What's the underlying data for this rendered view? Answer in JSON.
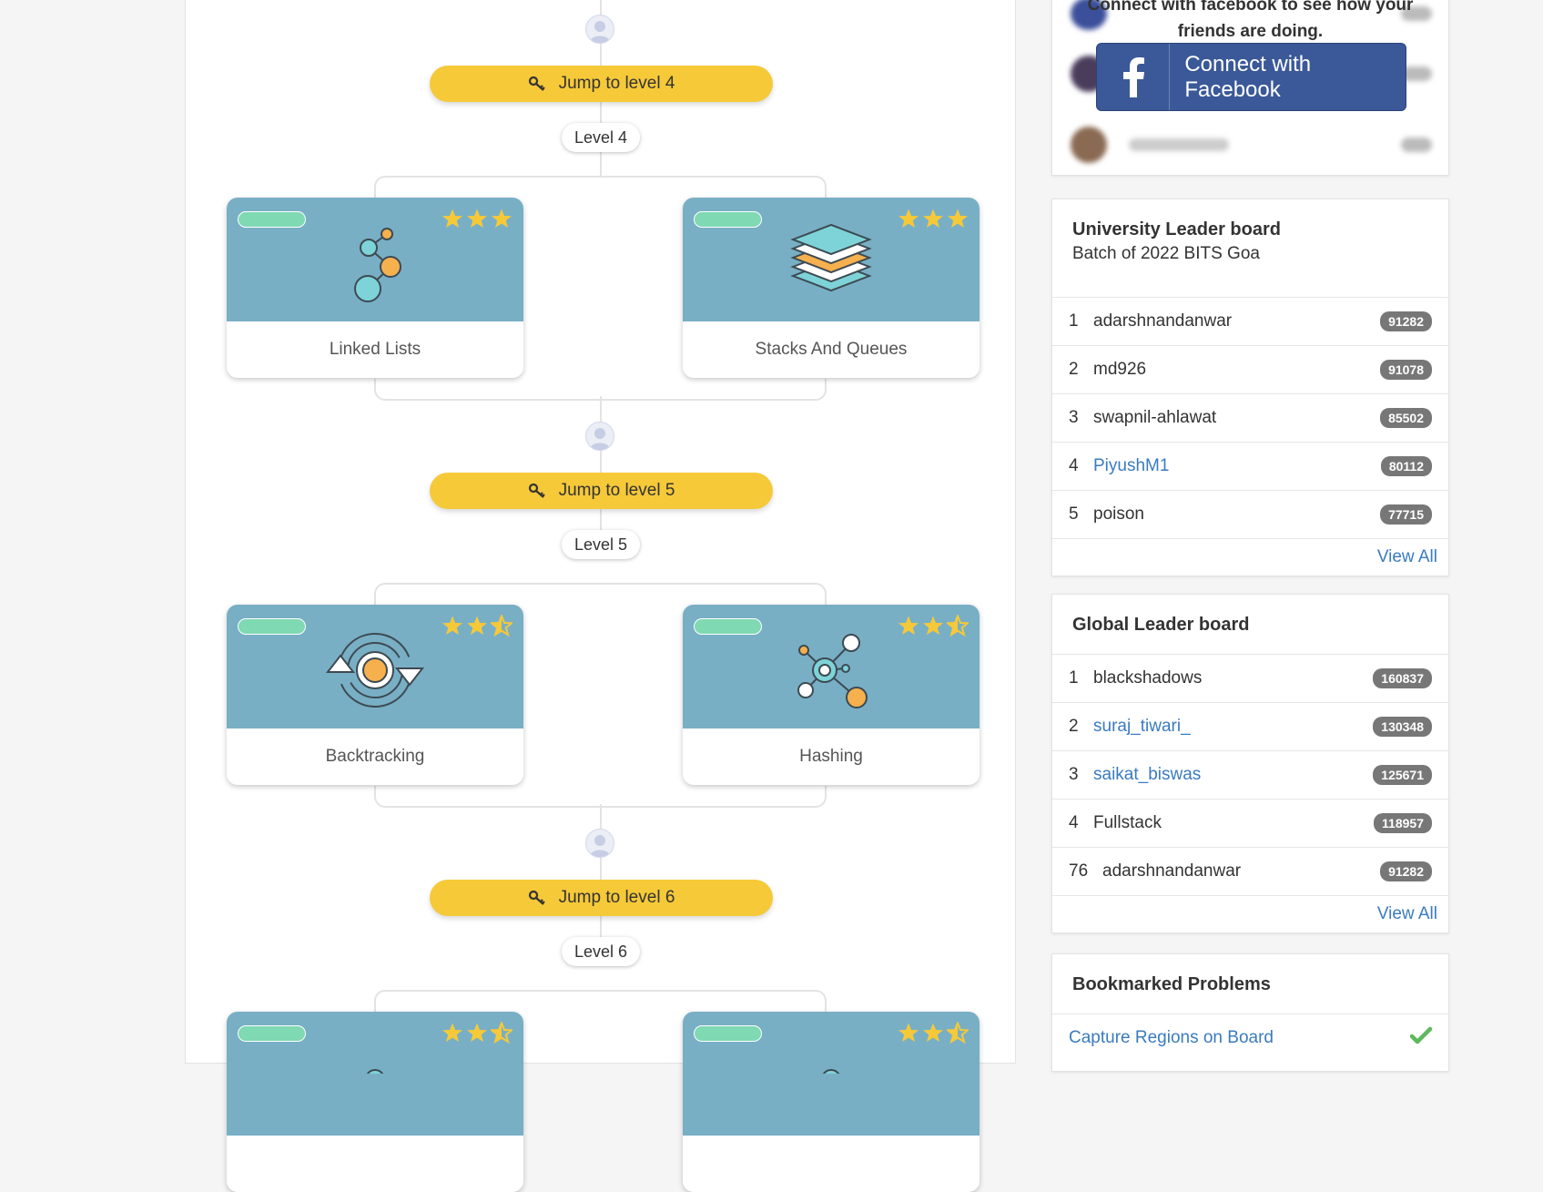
{
  "track": {
    "jump_buttons": [
      {
        "label": "Jump to level 4"
      },
      {
        "label": "Jump to level 5"
      },
      {
        "label": "Jump to level 6"
      }
    ],
    "levels": [
      {
        "label": "Level 4",
        "cards": [
          {
            "title": "Linked Lists",
            "stars": 3,
            "icon": "linked-list-icon"
          },
          {
            "title": "Stacks And Queues",
            "stars": 3,
            "icon": "stack-layers-icon"
          }
        ]
      },
      {
        "label": "Level 5",
        "cards": [
          {
            "title": "Backtracking",
            "stars": 2.5,
            "icon": "backtracking-icon"
          },
          {
            "title": "Hashing",
            "stars": 2.5,
            "icon": "hashing-icon"
          }
        ]
      },
      {
        "label": "Level 6",
        "cards": [
          {
            "title": "",
            "stars": 2.5
          },
          {
            "title": "",
            "stars": 2.5
          }
        ]
      }
    ]
  },
  "facebook": {
    "prompt": "Connect with facebook to see how your friends are doing.",
    "button_label": "Connect with Facebook"
  },
  "university_board": {
    "title": "University Leader board",
    "subtitle": "Batch of 2022 BITS Goa",
    "rows": [
      {
        "rank": "1",
        "name": "adarshnandanwar",
        "score": "91282",
        "link": false
      },
      {
        "rank": "2",
        "name": "md926",
        "score": "91078",
        "link": false
      },
      {
        "rank": "3",
        "name": "swapnil-ahlawat",
        "score": "85502",
        "link": false
      },
      {
        "rank": "4",
        "name": "PiyushM1",
        "score": "80112",
        "link": true
      },
      {
        "rank": "5",
        "name": "poison",
        "score": "77715",
        "link": false
      }
    ],
    "view_all": "View All"
  },
  "global_board": {
    "title": "Global Leader board",
    "rows": [
      {
        "rank": "1",
        "name": "blackshadows",
        "score": "160837",
        "link": false
      },
      {
        "rank": "2",
        "name": "suraj_tiwari_",
        "score": "130348",
        "link": true
      },
      {
        "rank": "3",
        "name": "saikat_biswas",
        "score": "125671",
        "link": true
      },
      {
        "rank": "4",
        "name": "Fullstack",
        "score": "118957",
        "link": false
      },
      {
        "rank": "76",
        "name": "adarshnandanwar",
        "score": "91282",
        "link": false
      }
    ],
    "view_all": "View All"
  },
  "bookmarks": {
    "title": "Bookmarked Problems",
    "items": [
      {
        "name": "Capture Regions on Board"
      }
    ]
  },
  "colors": {
    "jump_yellow": "#f6c939",
    "card_banner": "#78afc5",
    "progress_green": "#7fd9b2",
    "star_gold": "#f6c939",
    "link_blue": "#3a7bbf",
    "badge_gray": "#777777",
    "facebook_blue": "#3b5998",
    "check_green": "#5cb85c"
  }
}
